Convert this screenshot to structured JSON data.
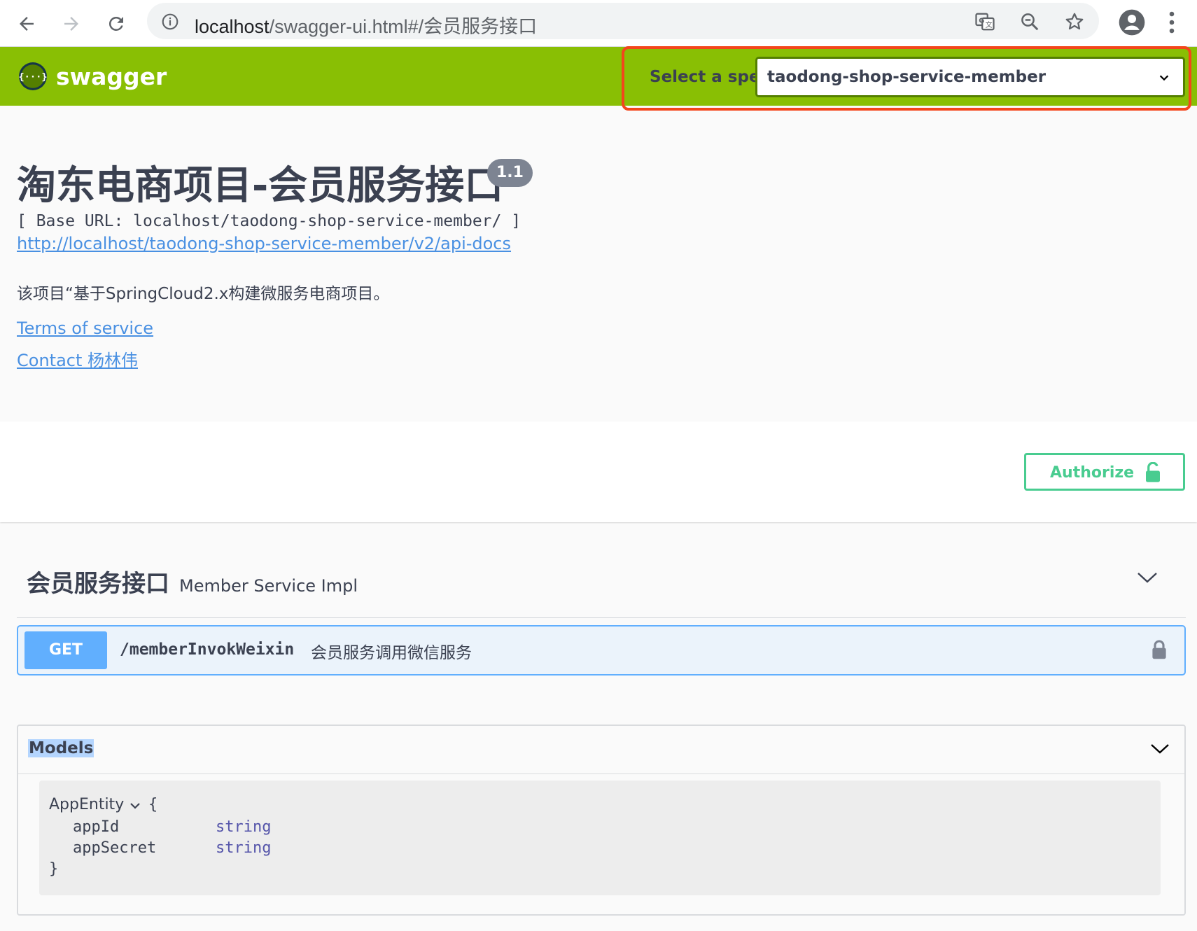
{
  "browser": {
    "url_host": "localhost",
    "url_rest": "/swagger-ui.html#/会员服务接口"
  },
  "topbar": {
    "brand": "swagger",
    "spec_label": "Select a spec",
    "spec_value": "taodong-shop-service-member"
  },
  "info": {
    "title": "淘东电商项目-会员服务接口",
    "version": "1.1",
    "base_url": "[ Base URL: localhost/taodong-shop-service-member/ ]",
    "api_docs_link": "http://localhost/taodong-shop-service-member/v2/api-docs",
    "description": "该项目“基于SpringCloud2.x构建微服务电商项目。",
    "terms_link": "Terms of service",
    "contact_link": "Contact 杨林伟"
  },
  "auth": {
    "authorize_label": "Authorize"
  },
  "tag": {
    "name": "会员服务接口",
    "description": "Member Service Impl",
    "operations": [
      {
        "method": "GET",
        "path": "/memberInvokWeixin",
        "summary": "会员服务调用微信服务"
      }
    ]
  },
  "models": {
    "title": "Models",
    "items": [
      {
        "name": "AppEntity",
        "open_brace": "{",
        "close_brace": "}",
        "properties": [
          {
            "name": "appId",
            "type": "string"
          },
          {
            "name": "appSecret",
            "type": "string"
          }
        ]
      }
    ]
  },
  "colors": {
    "topbar": "#89bf04",
    "get": "#61affe",
    "authorize": "#49cc90",
    "highlight": "#f3461c"
  }
}
